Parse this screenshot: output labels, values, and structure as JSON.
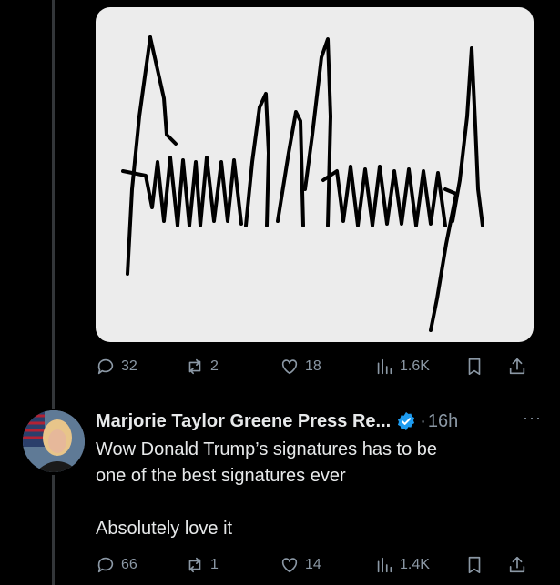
{
  "post1": {
    "media": {
      "kind": "signature-image",
      "background": "#ececec",
      "ink": "#000000",
      "alt_text": "Donald Trump"
    },
    "replies": "32",
    "reposts": "2",
    "likes": "18",
    "views": "1.6K"
  },
  "post2": {
    "author_name": "Marjorie Taylor Greene Press Re...",
    "verified": true,
    "separator": "·",
    "time": "16h",
    "more": "···",
    "text": "Wow Donald Trump’s signatures has to be\none of the best signatures ever\n\nAbsolutely love it",
    "replies": "66",
    "reposts": "1",
    "likes": "14",
    "views": "1.4K"
  },
  "colors": {
    "background": "#000000",
    "text": "#e7e9ea",
    "muted": "#8b98a5",
    "verified": "#1d9bf0",
    "thread_line": "#333639"
  },
  "icons": [
    "reply-icon",
    "repost-icon",
    "like-icon",
    "views-icon",
    "bookmark-icon",
    "share-icon",
    "verified-badge-icon",
    "more-icon"
  ]
}
